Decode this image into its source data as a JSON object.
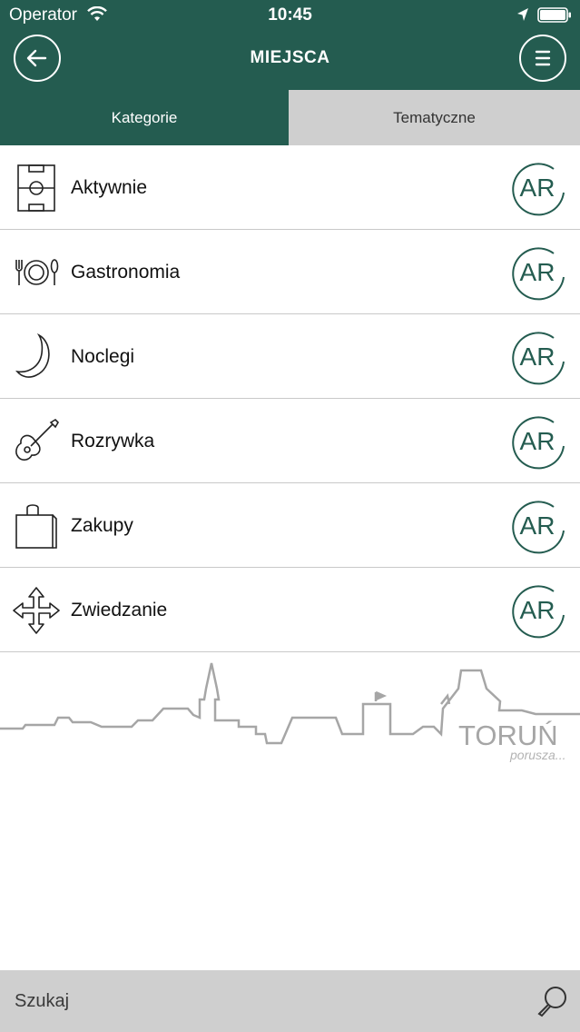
{
  "status_bar": {
    "carrier": "Operator",
    "time": "10:45"
  },
  "nav": {
    "title": "MIEJSCA",
    "back_icon": "arrow-left-icon",
    "menu_icon": "hamburger-menu-icon"
  },
  "tabs": [
    {
      "label": "Kategorie",
      "active": true
    },
    {
      "label": "Tematyczne",
      "active": false
    }
  ],
  "categories": [
    {
      "label": "Aktywnie",
      "icon": "football-pitch-icon",
      "ar_label": "AR"
    },
    {
      "label": "Gastronomia",
      "icon": "plate-cutlery-icon",
      "ar_label": "AR"
    },
    {
      "label": "Noclegi",
      "icon": "moon-icon",
      "ar_label": "AR"
    },
    {
      "label": "Rozrywka",
      "icon": "guitar-icon",
      "ar_label": "AR"
    },
    {
      "label": "Zakupy",
      "icon": "shopping-bag-icon",
      "ar_label": "AR"
    },
    {
      "label": "Zwiedzanie",
      "icon": "move-arrows-icon",
      "ar_label": "AR"
    }
  ],
  "brand": {
    "name": "TORUŃ",
    "tagline": "porusza..."
  },
  "search": {
    "placeholder": "Szukaj"
  },
  "colors": {
    "primary": "#245c50",
    "tab_inactive": "#cfcfcf",
    "search_bar": "#cfcfcf",
    "skyline": "#a6a6a6"
  }
}
